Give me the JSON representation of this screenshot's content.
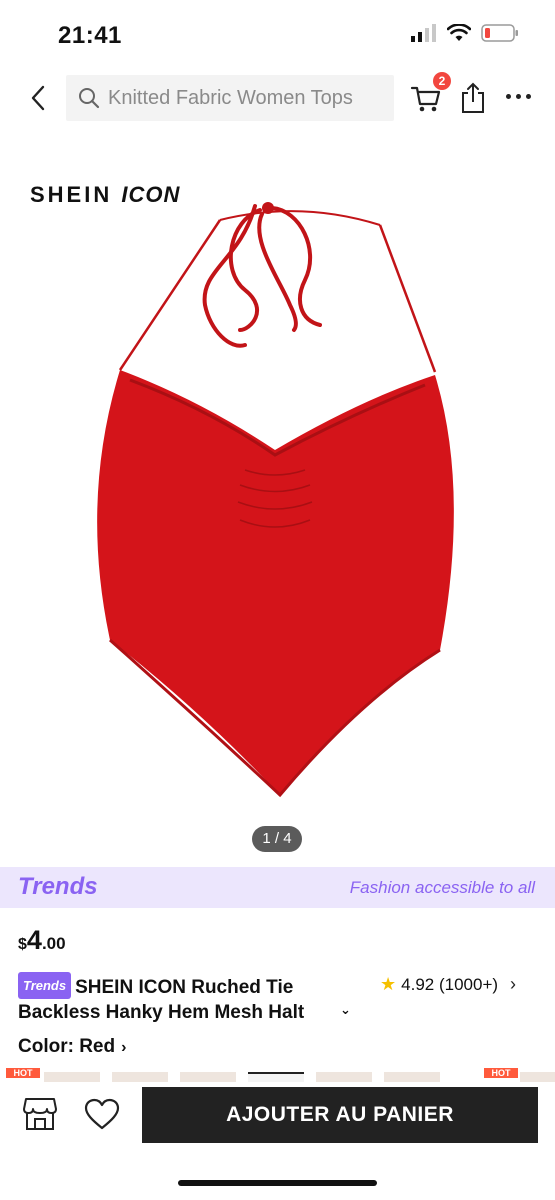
{
  "status_bar": {
    "time": "21:41",
    "battery_color": "#f2473f"
  },
  "nav": {
    "back_icon": "chevron-left-icon",
    "search_placeholder": "Knitted Fabric Women Tops",
    "cart_count": "2",
    "cart_icon": "cart-icon",
    "share_icon": "share-icon",
    "more_icon": "more-dots-icon"
  },
  "product": {
    "brand_prefix": "SHEIN ",
    "brand_suffix": "ICON",
    "image_color": "#d4141a",
    "page_indicator": "1 / 4"
  },
  "trends_bar": {
    "logo": "Trends",
    "tagline": "Fashion accessible to all"
  },
  "price": {
    "currency": "$",
    "whole": "4",
    "cents": ".00"
  },
  "title": {
    "pill": "Trends",
    "text": "SHEIN ICON Ruched Tie Backless Hanky Hem Mesh Halt"
  },
  "rating": {
    "value": "4.92",
    "count": "(1000+)"
  },
  "color": {
    "label": "Color: Red"
  },
  "swatch_tags": {
    "hot": "HOT"
  },
  "bottom_bar": {
    "add_to_cart": "AJOUTER AU PANIER",
    "store_icon": "store-icon",
    "wishlist_icon": "heart-icon"
  },
  "colors": {
    "accent_purple": "#8a63f2",
    "trends_bg": "#ece6fd",
    "badge_red": "#f2473f",
    "button_dark": "#222222",
    "star": "#f5c000"
  }
}
